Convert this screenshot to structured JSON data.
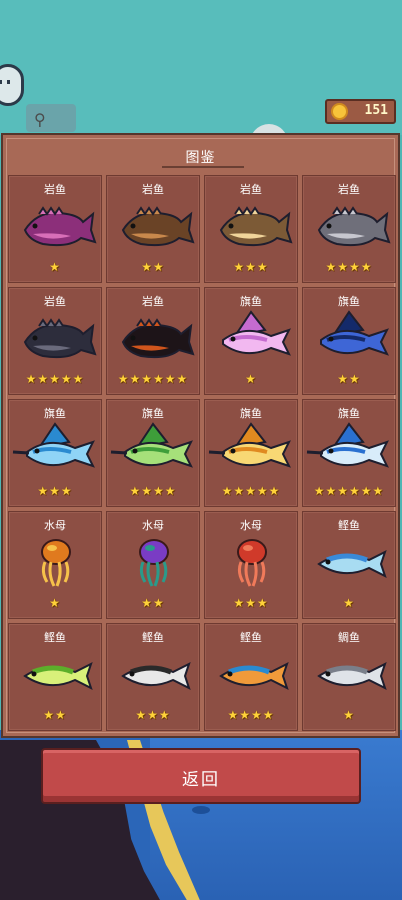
{
  "hud": {
    "coins": "151"
  },
  "panel": {
    "title": "图鉴"
  },
  "cards": [
    {
      "name": "岩鱼",
      "stars": "★",
      "colors": [
        "#8c2f7a",
        "#d86fb8"
      ],
      "kind": "rock"
    },
    {
      "name": "岩鱼",
      "stars": "★★",
      "colors": [
        "#6a4326",
        "#c8884c"
      ],
      "kind": "rock"
    },
    {
      "name": "岩鱼",
      "stars": "★★★",
      "colors": [
        "#7c5a36",
        "#f0d49a"
      ],
      "kind": "rock"
    },
    {
      "name": "岩鱼",
      "stars": "★★★★",
      "colors": [
        "#6f6f7a",
        "#c7c7cf"
      ],
      "kind": "rock"
    },
    {
      "name": "岩鱼",
      "stars": "★★★★★",
      "colors": [
        "#2d2d3c",
        "#6a6a7c"
      ],
      "kind": "rock"
    },
    {
      "name": "岩鱼",
      "stars": "★★★★★★",
      "colors": [
        "#1d1418",
        "#d0551c"
      ],
      "kind": "rock"
    },
    {
      "name": "旗鱼",
      "stars": "★",
      "colors": [
        "#c56bd0",
        "#f2b8f0"
      ],
      "kind": "flag"
    },
    {
      "name": "旗鱼",
      "stars": "★★",
      "colors": [
        "#142a6a",
        "#3e66d6"
      ],
      "kind": "flag"
    },
    {
      "name": "旗鱼",
      "stars": "★★★",
      "colors": [
        "#2a8ad0",
        "#8fd4f6"
      ],
      "kind": "sail"
    },
    {
      "name": "旗鱼",
      "stars": "★★★★",
      "colors": [
        "#3e9e3a",
        "#a6e07a"
      ],
      "kind": "sail"
    },
    {
      "name": "旗鱼",
      "stars": "★★★★★",
      "colors": [
        "#e08a20",
        "#f8d874"
      ],
      "kind": "sail"
    },
    {
      "name": "旗鱼",
      "stars": "★★★★★★",
      "colors": [
        "#2a70d0",
        "#d8ecfa"
      ],
      "kind": "sail"
    },
    {
      "name": "水母",
      "stars": "★",
      "colors": [
        "#e07a1e",
        "#f6c24a"
      ],
      "kind": "jelly"
    },
    {
      "name": "水母",
      "stars": "★★",
      "colors": [
        "#7a3cc4",
        "#2a9a8a"
      ],
      "kind": "jelly"
    },
    {
      "name": "水母",
      "stars": "★★★",
      "colors": [
        "#d03a2a",
        "#f07a5a"
      ],
      "kind": "jelly"
    },
    {
      "name": "鲣鱼",
      "stars": "★",
      "colors": [
        "#3a8ad8",
        "#a8dcf2"
      ],
      "kind": "bonito"
    },
    {
      "name": "鲣鱼",
      "stars": "★★",
      "colors": [
        "#5cae2a",
        "#d8f07a"
      ],
      "kind": "bonito"
    },
    {
      "name": "鲣鱼",
      "stars": "★★★",
      "colors": [
        "#2a2a2a",
        "#e8e8e8"
      ],
      "kind": "bonito"
    },
    {
      "name": "鲣鱼",
      "stars": "★★★★",
      "colors": [
        "#2a8ad0",
        "#f09a3a"
      ],
      "kind": "bonito"
    },
    {
      "name": "鲷鱼",
      "stars": "★",
      "colors": [
        "#7a7f8a",
        "#dfe3e8"
      ],
      "kind": "bonito"
    }
  ],
  "back_button": {
    "label": "返回"
  }
}
